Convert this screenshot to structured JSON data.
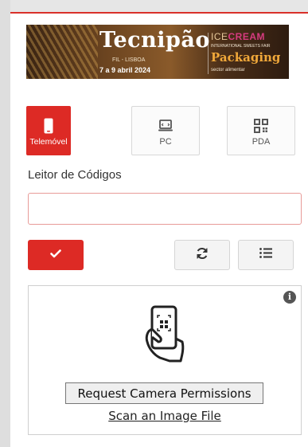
{
  "banner": {
    "title": "Tecnipão",
    "sub_location": "FIL - LISBOA",
    "sub_dates": "7 a 9 abril 2024",
    "ice_a": "ICE",
    "ice_b": "CREAM",
    "ice_sub": "INTERNATIONAL SWEETS FAIR",
    "packaging": "Packaging",
    "packaging_sub": "sector alimentar"
  },
  "modes": [
    {
      "label": "Telemóvel",
      "icon": "smartphone-icon",
      "active": true
    },
    {
      "label": "PC",
      "icon": "laptop-icon",
      "active": false
    },
    {
      "label": "PDA",
      "icon": "qr-grid-icon",
      "active": false
    }
  ],
  "reader": {
    "label": "Leitor de Códigos",
    "value": "",
    "placeholder": ""
  },
  "actions": {
    "confirm_icon": "check-icon",
    "refresh_icon": "refresh-icon",
    "list_icon": "list-icon"
  },
  "scanner": {
    "info": "i",
    "request_permissions": "Request Camera Permissions",
    "scan_file": "Scan an Image File"
  },
  "colors": {
    "accent": "#dd2a25",
    "input_border": "#e89b98"
  }
}
